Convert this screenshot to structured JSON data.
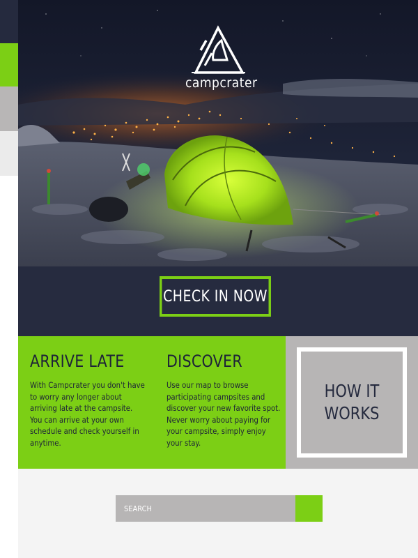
{
  "brand": {
    "name": "campcrater"
  },
  "hero": {
    "description": "night camping tent on snowy mountain above city lights"
  },
  "cta": {
    "label": "CHECK IN NOW"
  },
  "features": [
    {
      "title": "ARRIVE LATE",
      "body": "With Campcrater you don't have to worry any longer about arriving late at the campsite. You can arrive at your own schedule and check yourself in anytime."
    },
    {
      "title": "DISCOVER",
      "body": "Use our map to browse participating campsites and discover your new favorite spot. Never worry about paying for your campsite, simply enjoy your stay."
    }
  ],
  "how_it_works": {
    "label": "HOW IT WORKS"
  },
  "search": {
    "placeholder": "SEARCH",
    "value": ""
  },
  "colors": {
    "navy": "#252a3e",
    "green": "#7ccf15",
    "gray": "#b7b5b5",
    "light": "#f4f4f4"
  }
}
